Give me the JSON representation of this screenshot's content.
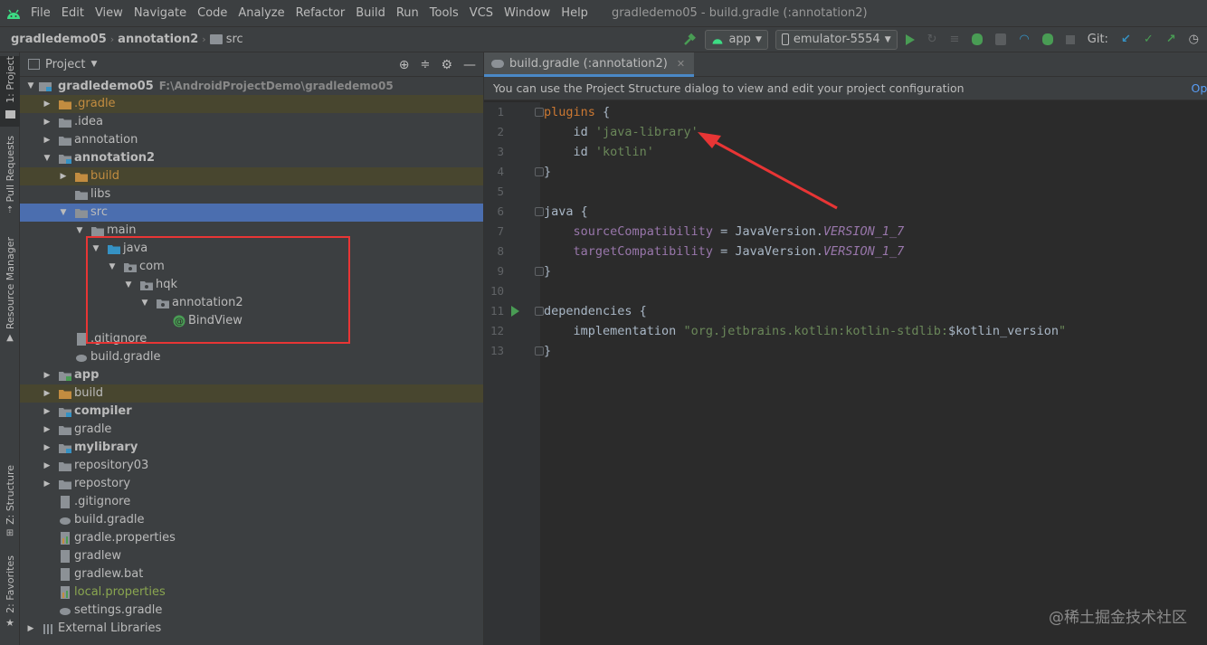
{
  "menubar": {
    "items": [
      "File",
      "Edit",
      "View",
      "Navigate",
      "Code",
      "Analyze",
      "Refactor",
      "Build",
      "Run",
      "Tools",
      "VCS",
      "Window",
      "Help"
    ],
    "window_title": "gradledemo05 - build.gradle (:annotation2)"
  },
  "navbar": {
    "crumbs": [
      "gradledemo05",
      "annotation2",
      "src"
    ],
    "run_config": "app",
    "device": "emulator-5554",
    "git_label": "Git:"
  },
  "left_stripe": {
    "tabs": [
      "1: Project",
      "Pull Requests",
      "Resource Manager",
      "Z: Structure",
      "2: Favorites"
    ]
  },
  "project_panel": {
    "title": "Project",
    "root_name": "gradledemo05",
    "root_path": "F:\\AndroidProjectDemo\\gradledemo05",
    "tree": [
      {
        "label": ".gradle"
      },
      {
        "label": ".idea"
      },
      {
        "label": "annotation"
      },
      {
        "label": "annotation2"
      },
      {
        "label": "build"
      },
      {
        "label": "libs"
      },
      {
        "label": "src"
      },
      {
        "label": "main"
      },
      {
        "label": "java"
      },
      {
        "label": "com"
      },
      {
        "label": "hqk"
      },
      {
        "label": "annotation2"
      },
      {
        "label": "BindView"
      },
      {
        "label": ".gitignore"
      },
      {
        "label": "build.gradle"
      },
      {
        "label": "app"
      },
      {
        "label": "build"
      },
      {
        "label": "compiler"
      },
      {
        "label": "gradle"
      },
      {
        "label": "mylibrary"
      },
      {
        "label": "repository03"
      },
      {
        "label": "repostory"
      },
      {
        "label": ".gitignore"
      },
      {
        "label": "build.gradle"
      },
      {
        "label": "gradle.properties"
      },
      {
        "label": "gradlew"
      },
      {
        "label": "gradlew.bat"
      },
      {
        "label": "local.properties"
      },
      {
        "label": "settings.gradle"
      },
      {
        "label": "External Libraries"
      }
    ]
  },
  "editor": {
    "tab_label": "build.gradle (:annotation2)",
    "banner": "You can use the Project Structure dialog to view and edit your project configuration",
    "banner_action": "Ope",
    "line_numbers": [
      "1",
      "2",
      "3",
      "4",
      "5",
      "6",
      "7",
      "8",
      "9",
      "10",
      "11",
      "12",
      "13"
    ],
    "code": {
      "l1_kw": "plugins",
      "l1_rest": " {",
      "l2_id": "id ",
      "l2_str": "'java-library'",
      "l3_id": "id ",
      "l3_str": "'kotlin'",
      "l4": "}",
      "l6_kw": "java",
      "l6_rest": " {",
      "l7_field": "sourceCompatibility",
      "l7_mid": " = JavaVersion.",
      "l7_const": "VERSION_1_7",
      "l8_field": "targetCompatibility",
      "l8_mid": " = JavaVersion.",
      "l8_const": "VERSION_1_7",
      "l9": "}",
      "l11_kw": "dependencies",
      "l11_rest": " {",
      "l12_impl": "implementation ",
      "l12_str": "\"org.jetbrains.kotlin:kotlin-stdlib:",
      "l12_var": "$kotlin_version",
      "l12_end": "\"",
      "l13": "}"
    }
  },
  "watermark": "@稀土掘金技术社区",
  "colors": {
    "selection": "#4b6eaf",
    "annotation_box": "#e83535",
    "arrow": "#e83535"
  }
}
